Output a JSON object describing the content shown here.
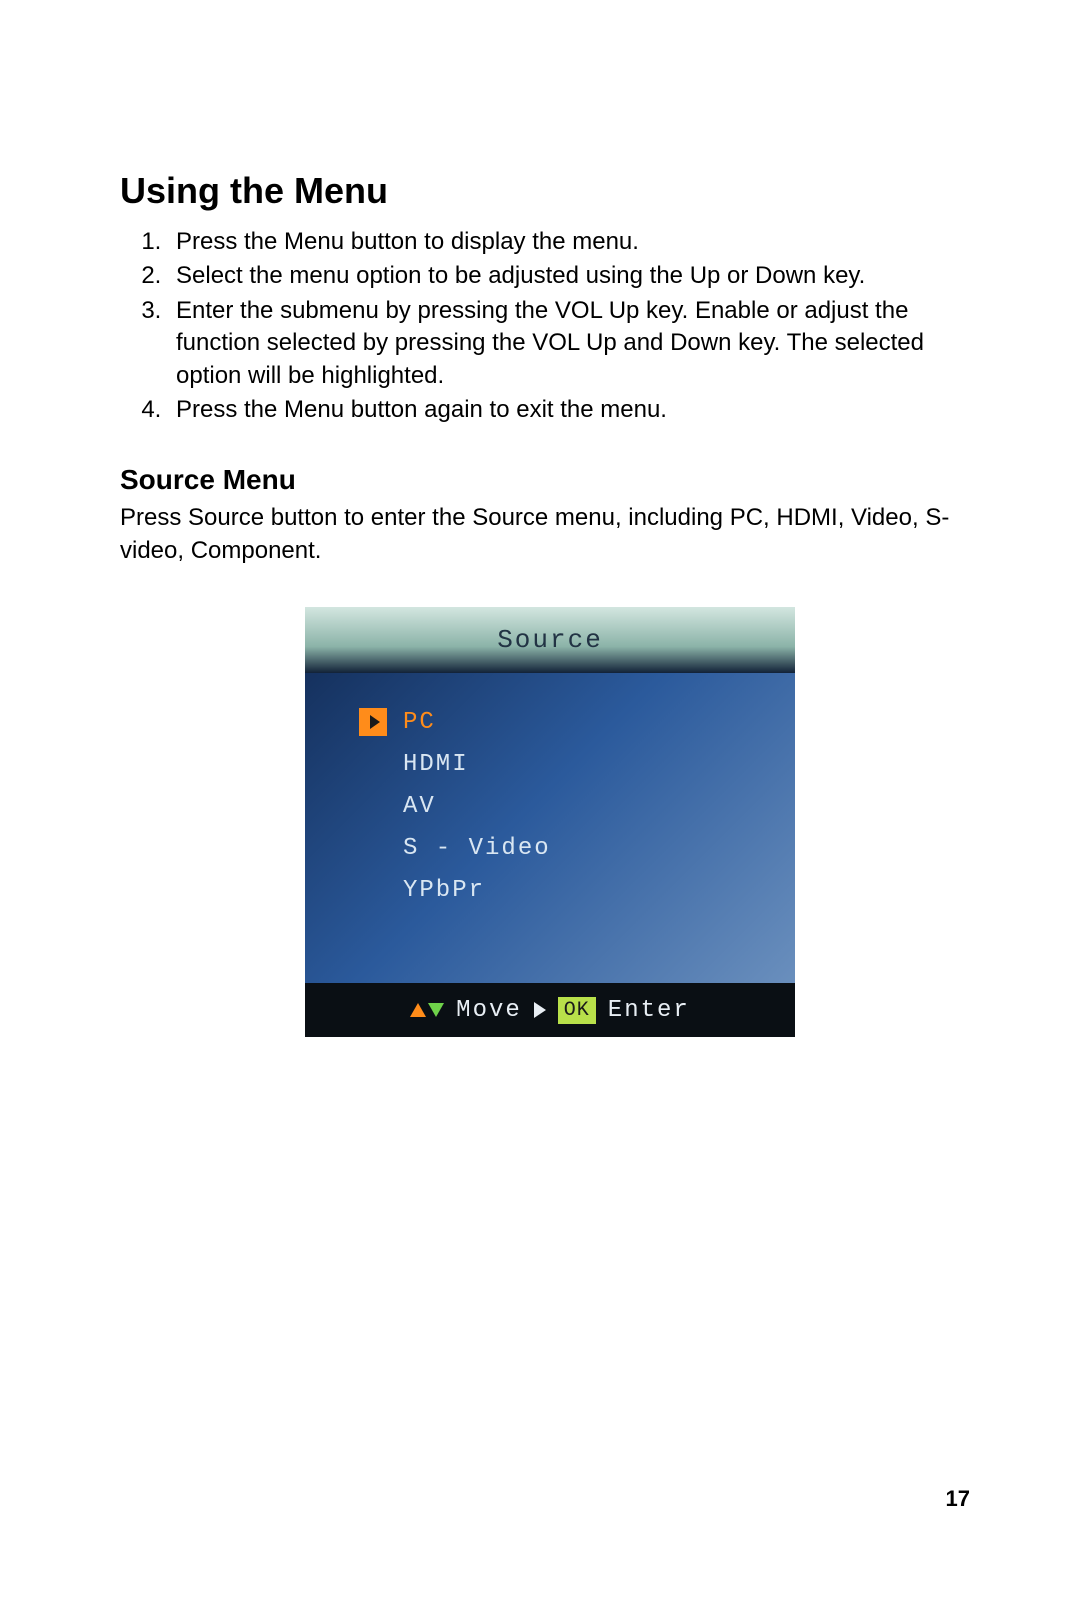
{
  "heading": "Using the Menu",
  "steps": [
    "Press the Menu button to display the menu.",
    "Select the menu option to be adjusted using the Up or Down key.",
    "Enter the submenu by pressing the VOL Up key. Enable or adjust the function selected by pressing the VOL Up and Down key. The selected option will be highlighted.",
    "Press the Menu button again to exit the menu."
  ],
  "sub_heading": "Source Menu",
  "sub_text": "Press Source button to enter the Source menu, including PC, HDMI, Video, S-video, Component.",
  "osd": {
    "title": "Source",
    "items": [
      "PC",
      "HDMI",
      "AV",
      "S - Video",
      "YPbPr"
    ],
    "selected_index": 0,
    "footer": {
      "move_label": "Move",
      "ok_label": "OK",
      "enter_label": "Enter"
    }
  },
  "page_number": "17"
}
